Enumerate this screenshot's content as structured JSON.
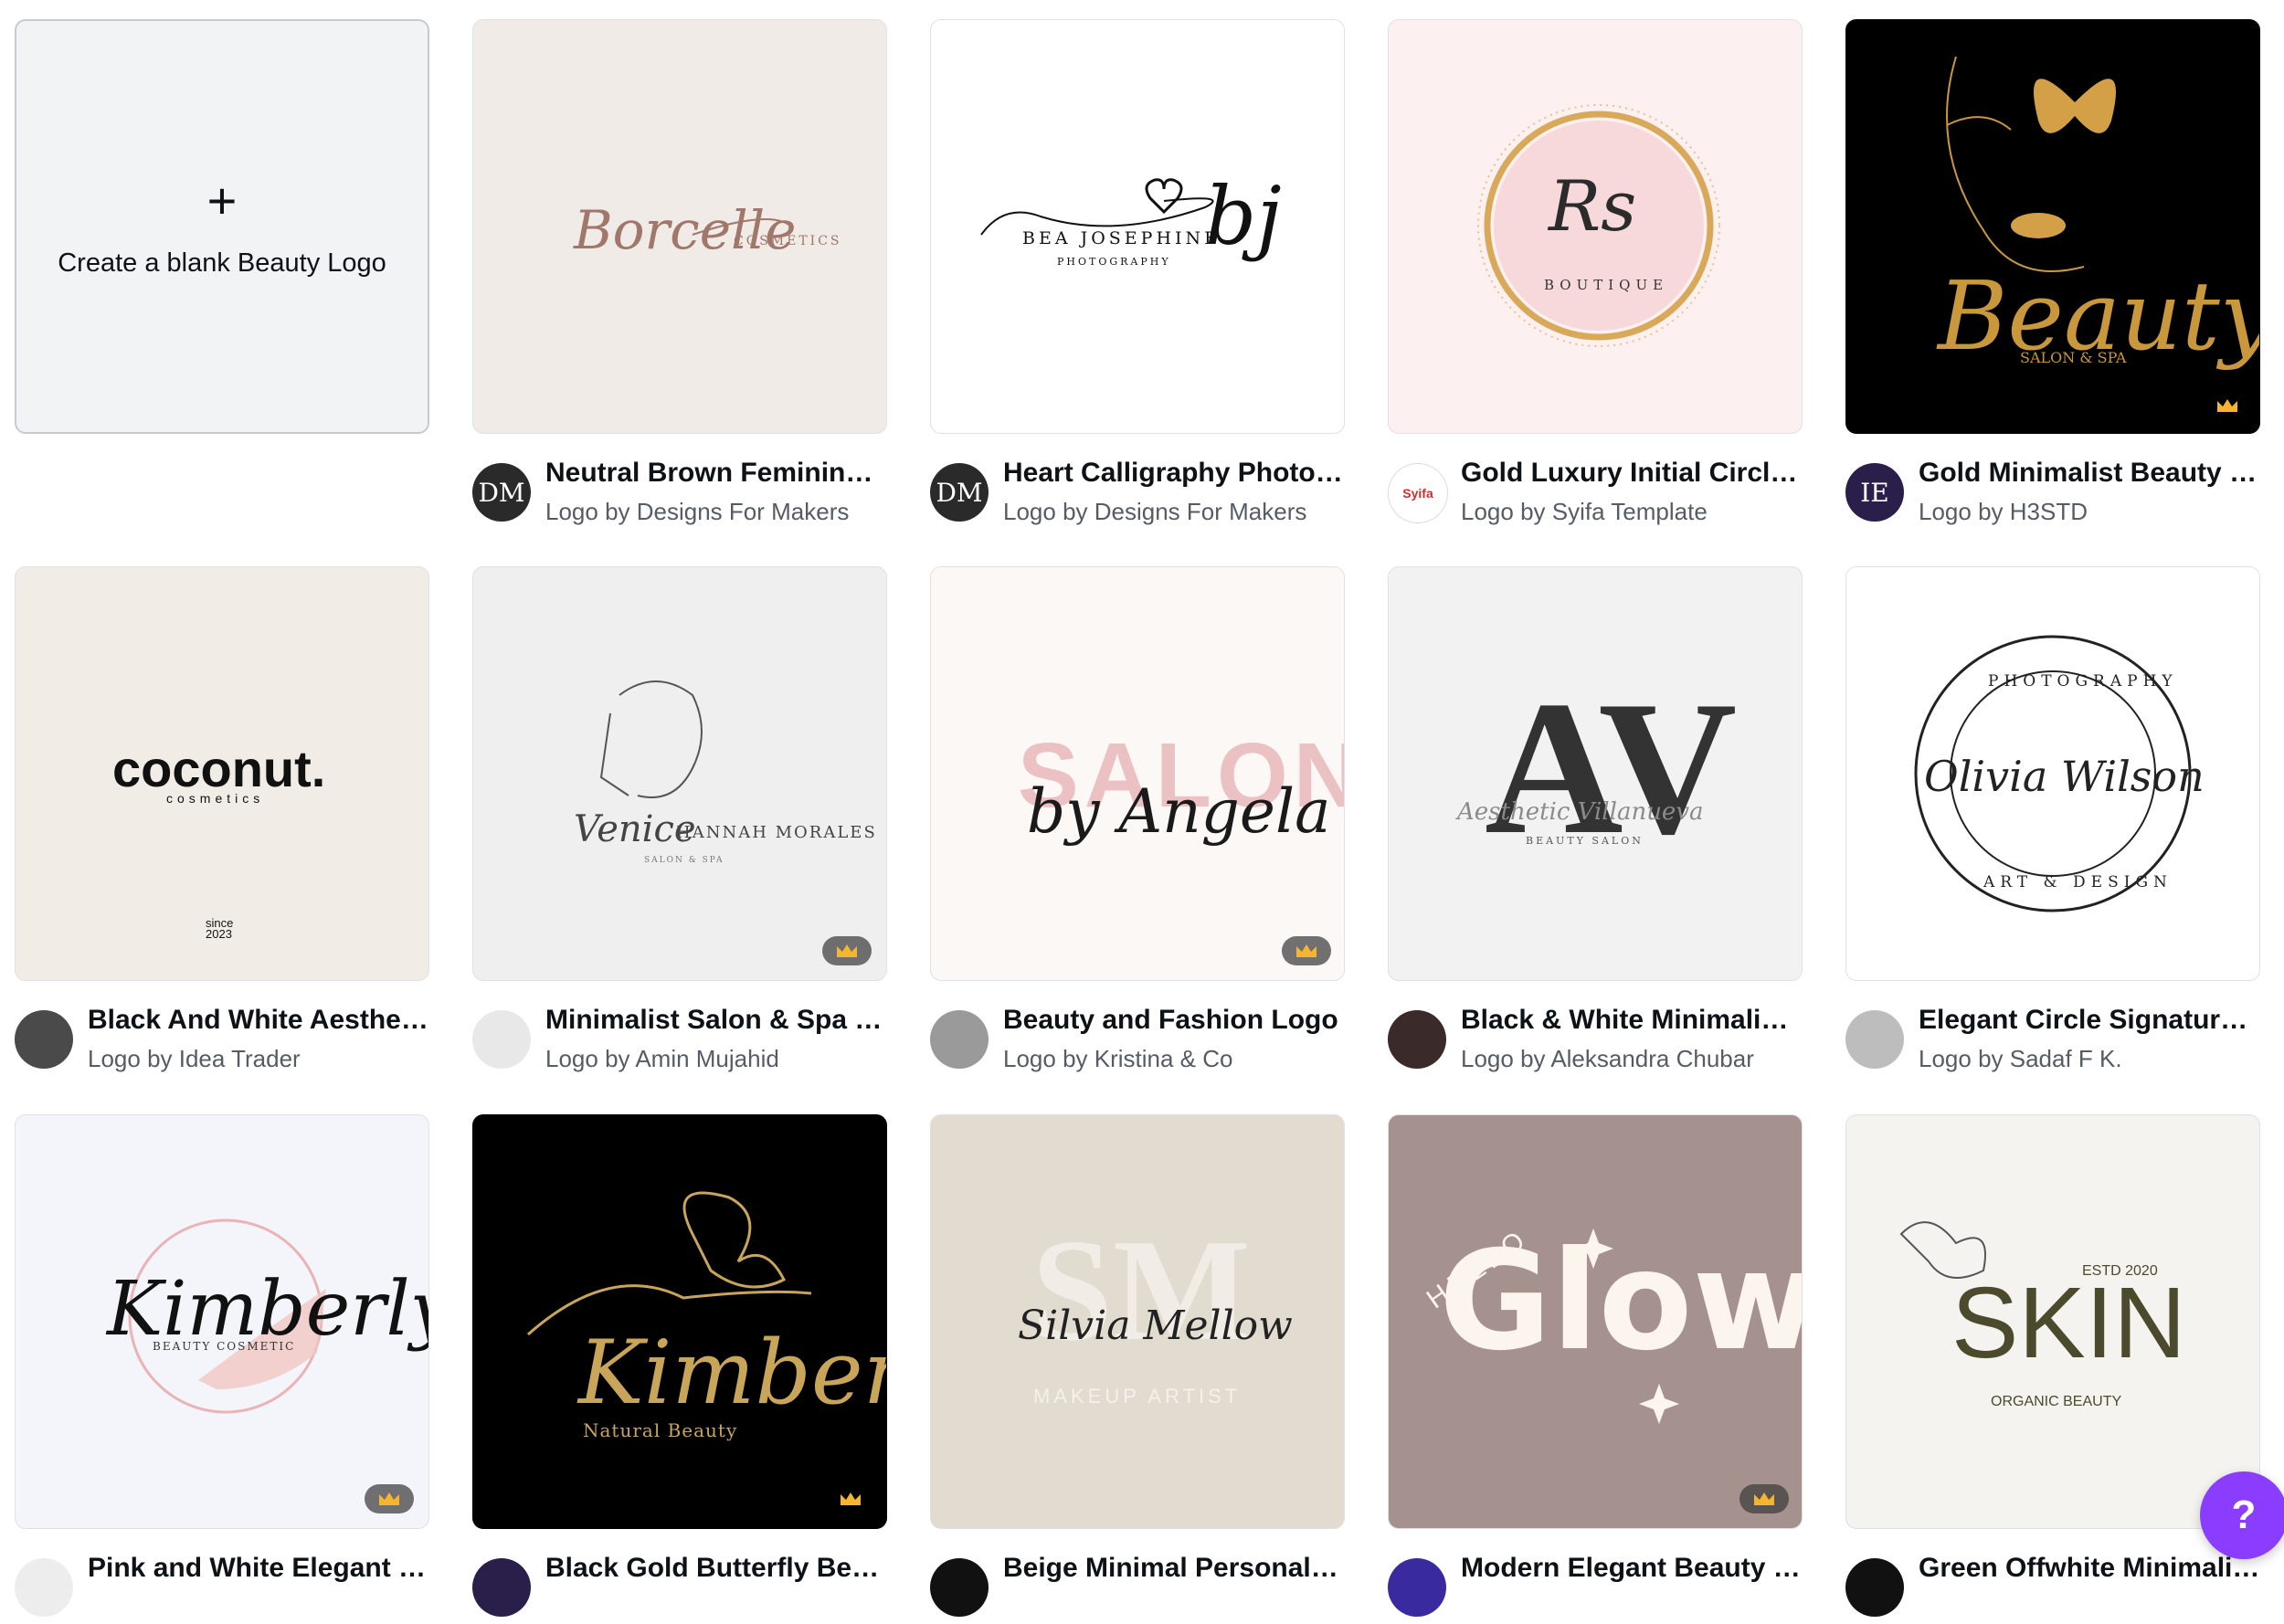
{
  "blank": {
    "plus": "+",
    "label": "Create a blank Beauty Logo"
  },
  "cards": [
    {
      "title": "Neutral Brown Feminine ...",
      "sub": "Logo by Designs For Makers",
      "avatar": "DM",
      "art": {
        "main": "Borcelle",
        "small": "COSMETICS"
      }
    },
    {
      "title": "Heart Calligraphy Photog...",
      "sub": "Logo by Designs For Makers",
      "avatar": "DM",
      "art": {
        "main": "bj",
        "name": "BEA JOSEPHINE",
        "small": "PHOTOGRAPHY"
      }
    },
    {
      "title": "Gold Luxury Initial Circle ...",
      "sub": "Logo by Syifa Template",
      "avatar": "Syifa",
      "art": {
        "main": "Rs",
        "small": "BOUTIQUE"
      }
    },
    {
      "title": "Gold Minimalist Beauty S...",
      "sub": "Logo by H3STD",
      "avatar": "IE",
      "art": {
        "main": "Beauty",
        "small": "SALON & SPA"
      }
    },
    {
      "title": "Black And White Aestheti...",
      "sub": "Logo by Idea Trader",
      "avatar": "",
      "art": {
        "main": "coconut.",
        "small": "cosmetics",
        "since": "since",
        "year": "2023"
      }
    },
    {
      "title": "Minimalist Salon & Spa R...",
      "sub": "Logo by Amin Mujahid",
      "avatar": "",
      "art": {
        "main": "Venice",
        "name": "HANNAH MORALES",
        "small": "SALON & SPA"
      }
    },
    {
      "title": "Beauty and Fashion Logo",
      "sub": "Logo by Kristina & Co",
      "avatar": "",
      "art": {
        "bg": "SALON",
        "main": "by Angela"
      }
    },
    {
      "title": "Black & White Minimalist ...",
      "sub": "Logo by Aleksandra Chubar",
      "avatar": "",
      "art": {
        "main": "AV",
        "name": "Aesthetic Villanueva",
        "small": "BEAUTY SALON"
      }
    },
    {
      "title": "Elegant Circle Signature ...",
      "sub": "Logo by Sadaf F K.",
      "avatar": "",
      "art": {
        "main": "Olivia Wilson",
        "top": "PHOTOGRAPHY",
        "bottom": "ART & DESIGN"
      }
    },
    {
      "title": "Pink and White Elegant B...",
      "sub": "",
      "avatar": "",
      "art": {
        "main": "Kimberly",
        "small": "BEAUTY COSMETIC"
      }
    },
    {
      "title": "Black Gold Butterfly Bea...",
      "sub": "",
      "avatar": "",
      "art": {
        "main": "Kimberly",
        "small": "Natural Beauty"
      }
    },
    {
      "title": "Beige Minimal Personal M...",
      "sub": "",
      "avatar": "",
      "art": {
        "bg": "SM",
        "main": "Silvia Mellow",
        "small": "MAKEUP ARTIST"
      }
    },
    {
      "title": "Modern Elegant Beauty S...",
      "sub": "",
      "avatar": "",
      "art": {
        "main": "Glow",
        "name": "HELLO"
      }
    },
    {
      "title": "Green Offwhite Minimalis...",
      "sub": "",
      "avatar": "",
      "art": {
        "main": "SKIN",
        "name": "ESTD 2020",
        "small": "ORGANIC BEAUTY"
      }
    }
  ],
  "help": "?",
  "colors": {
    "accent": "#8b3dff",
    "gold": "#c9973c",
    "crown": "#f5b52e"
  }
}
